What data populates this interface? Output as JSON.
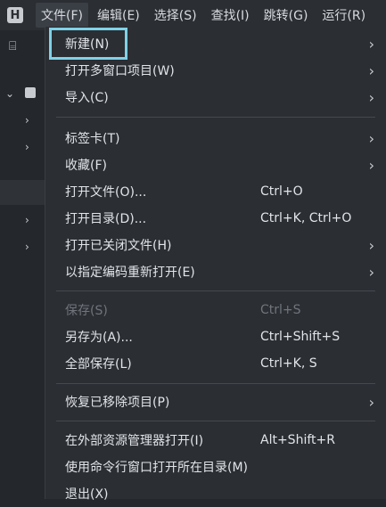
{
  "menubar": {
    "logo_letter": "H",
    "items": [
      {
        "label": "文件(F)",
        "active": true
      },
      {
        "label": "编辑(E)"
      },
      {
        "label": "选择(S)"
      },
      {
        "label": "查找(I)"
      },
      {
        "label": "跳转(G)"
      },
      {
        "label": "运行(R)"
      }
    ]
  },
  "sidebar": {
    "letter": "H",
    "icons": [
      "cursor-icon",
      "chevron-icons"
    ]
  },
  "file_menu": {
    "items": [
      {
        "label": "新建(N)",
        "submenu": true
      },
      {
        "label": "打开多窗口项目(W)",
        "submenu": true
      },
      {
        "label": "导入(C)",
        "submenu": true
      },
      {
        "label": "标签卡(T)",
        "submenu": true
      },
      {
        "label": "收藏(F)",
        "submenu": true
      },
      {
        "label": "打开文件(O)...",
        "shortcut": "Ctrl+O"
      },
      {
        "label": "打开目录(D)...",
        "shortcut": "Ctrl+K, Ctrl+O"
      },
      {
        "label": "打开已关闭文件(H)",
        "submenu": true
      },
      {
        "label": "以指定编码重新打开(E)",
        "submenu": true
      },
      {
        "label": "保存(S)",
        "shortcut": "Ctrl+S",
        "disabled": true
      },
      {
        "label": "另存为(A)...",
        "shortcut": "Ctrl+Shift+S"
      },
      {
        "label": "全部保存(L)",
        "shortcut": "Ctrl+K, S"
      },
      {
        "label": "恢复已移除项目(P)",
        "submenu": true
      },
      {
        "label": "在外部资源管理器打开(I)",
        "shortcut": "Alt+Shift+R"
      },
      {
        "label": "使用命令行窗口打开所在目录(M)"
      },
      {
        "label": "退出(X)"
      }
    ],
    "arrow_glyph": "›"
  },
  "colors": {
    "background": "#24272b",
    "menu_bg": "#2b2e33",
    "focus": "#7fd2e8"
  }
}
